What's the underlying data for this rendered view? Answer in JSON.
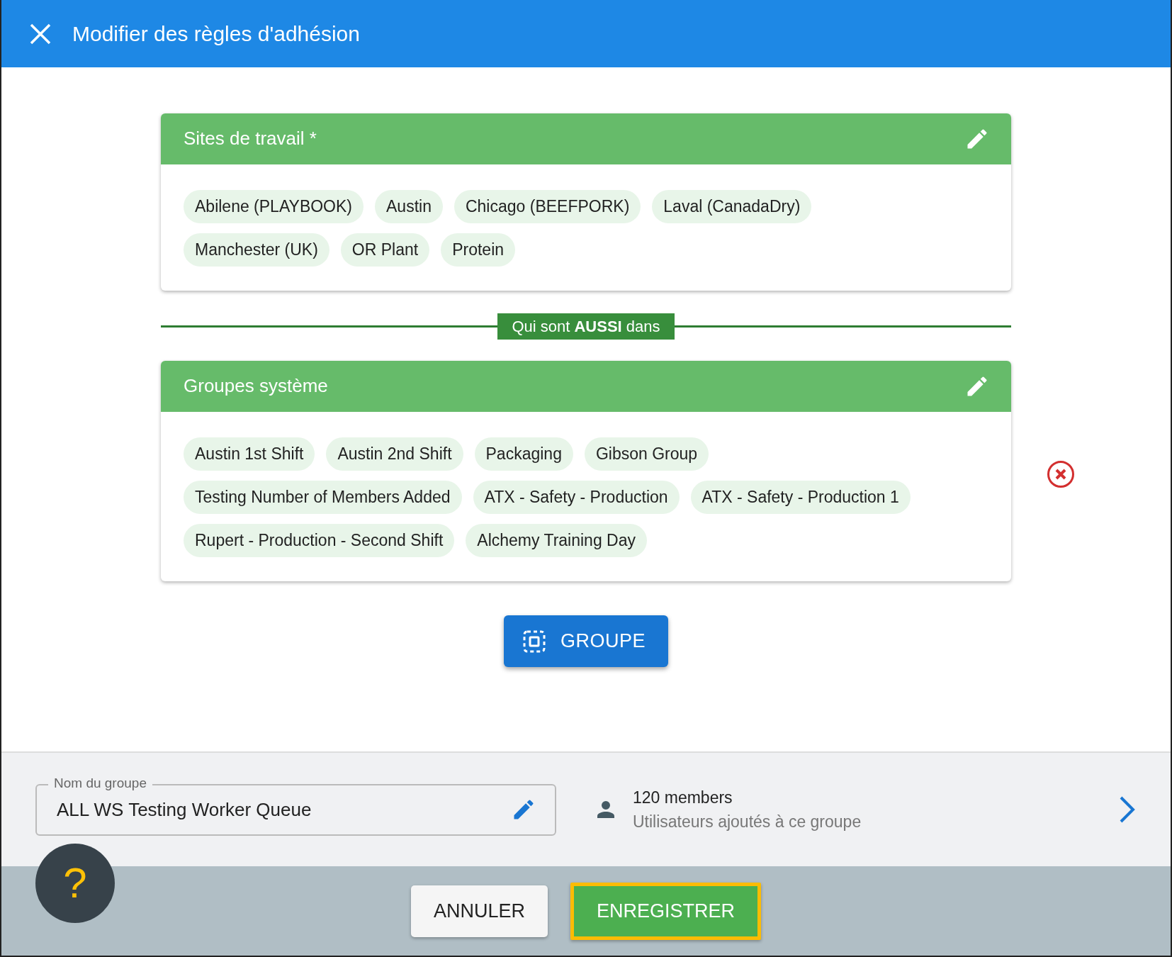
{
  "window": {
    "title": "Modifier des règles d'adhésion"
  },
  "rule_sections": [
    {
      "title": "Sites de travail *",
      "removable": false,
      "chips": [
        "Abilene (PLAYBOOK)",
        "Austin",
        "Chicago (BEEFPORK)",
        "Laval (CanadaDry)",
        "Manchester (UK)",
        "OR Plant",
        "Protein"
      ]
    },
    {
      "title": "Groupes système",
      "removable": true,
      "chips": [
        "Austin 1st Shift",
        "Austin 2nd Shift",
        "Packaging",
        "Gibson Group",
        "Testing Number of Members Added",
        "ATX - Safety - Production",
        "ATX - Safety - Production 1",
        "Rupert - Production - Second Shift",
        "Alchemy Training Day"
      ]
    }
  ],
  "connector": "Qui sont **AUSSI** dans",
  "add_button": "GROUPE",
  "group_name": {
    "label": "Nom du groupe",
    "value": "ALL WS Testing Worker Queue"
  },
  "members": {
    "count": "120 members",
    "subtitle": "Utilisateurs ajoutés à ce groupe"
  },
  "help": "?",
  "buttons": [
    {
      "label": "ANNULER",
      "kind": "secondary"
    },
    {
      "label": "ENREGISTRER",
      "kind": "primary"
    }
  ]
}
